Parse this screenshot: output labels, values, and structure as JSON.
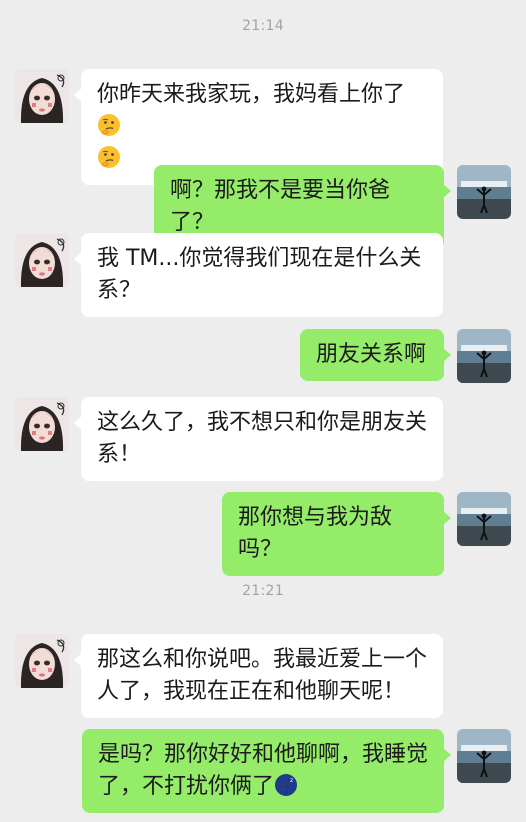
{
  "timestamps": [
    "21:14",
    "21:21"
  ],
  "messages": [
    {
      "side": "left",
      "text": "你昨天来我家玩，我妈看上你了",
      "emoji": [
        "thinking-face",
        "thinking-face"
      ]
    },
    {
      "side": "right",
      "text": "啊？那我不是要当你爸了？"
    },
    {
      "side": "left",
      "text": "我 TM...你觉得我们现在是什么关系？"
    },
    {
      "side": "right",
      "text": "朋友关系啊"
    },
    {
      "side": "left",
      "text": "这么久了，我不想只和你是朋友关系！"
    },
    {
      "side": "right",
      "text": "那你想与我为敌吗？"
    },
    {
      "side": "left",
      "text": "那这么和你说吧。我最近爱上一个人了，我现在正在和他聊天呢！"
    },
    {
      "side": "right",
      "text": "是吗？那你好好和他聊啊，我睡觉了，不打扰你俩了",
      "emoji": [
        "sleeping-moon-face"
      ]
    }
  ],
  "colors": {
    "background": "#ededed",
    "bubble_left": "#ffffff",
    "bubble_right": "#95ec69",
    "timestamp": "#a3a3a3",
    "text": "#1b1b1b"
  },
  "icons": {
    "girl_avatar": "girl-avatar",
    "me_avatar": "person-by-sea-avatar"
  }
}
